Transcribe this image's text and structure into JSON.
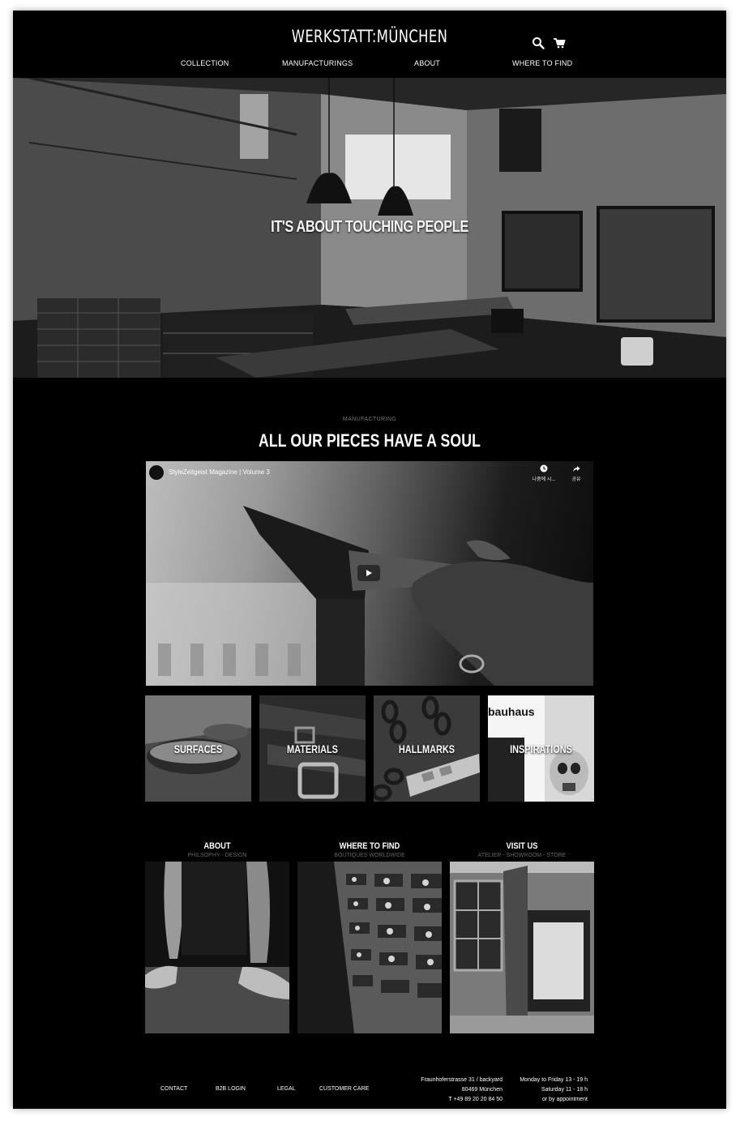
{
  "brand": {
    "logo_text": "WERKSTATT:MÜNCHEN"
  },
  "header": {
    "icons": [
      "search-icon",
      "cart-icon"
    ],
    "nav": [
      {
        "label": "COLLECTION"
      },
      {
        "label": "MANUFACTURINGS"
      },
      {
        "label": "ABOUT"
      },
      {
        "label": "WHERE TO FIND"
      }
    ]
  },
  "hero": {
    "title": "IT'S ABOUT TOUCHING PEOPLE"
  },
  "manufacturing": {
    "label": "MANUFACTURING",
    "title": "ALL OUR PIECES HAVE A SOUL",
    "video": {
      "title": "StyleZeitgeist Magazine | Volume 3",
      "watch_later": "나중에 시...",
      "share": "공유"
    },
    "tiles": [
      {
        "label": "SURFACES"
      },
      {
        "label": "MATERIALS"
      },
      {
        "label": "HALLMARKS"
      },
      {
        "label": "INSPIRATIONS",
        "sign_text": "bauhaus"
      }
    ]
  },
  "columns": [
    {
      "title": "ABOUT",
      "subtitle": "PHILSOPHY - DESIGN"
    },
    {
      "title": "WHERE TO FIND",
      "subtitle": "BOUTIQUES WORLDWIDE"
    },
    {
      "title": "VISIT US",
      "subtitle": "ATELIER - SHOWROOM - STORE"
    }
  ],
  "footer": {
    "links": [
      {
        "label": "CONTACT"
      },
      {
        "label": "B2B LOGIN"
      },
      {
        "label": "LEGAL"
      },
      {
        "label": "CUSTOMER CARE"
      }
    ],
    "address": [
      "Fraunhoferstrasse 31 / backyard",
      "80469 München",
      "T +49 89 20 20 84 50"
    ],
    "hours": [
      "Monday to Friday 13 - 19 h",
      "Saturday 11 - 18 h",
      "or by appointment"
    ]
  },
  "colors": {
    "background": "#000000",
    "text": "#ffffff",
    "muted": "#777777"
  }
}
